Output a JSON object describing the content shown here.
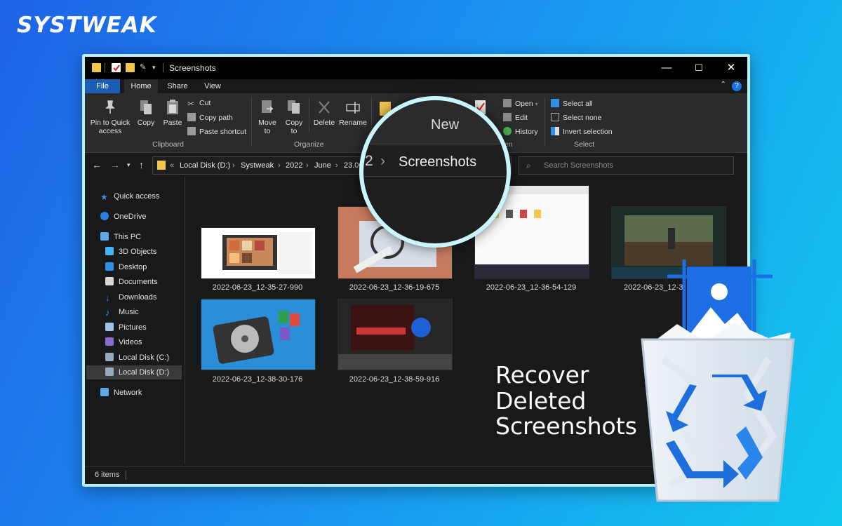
{
  "brand": {
    "logo_text": "SYSTWEAK"
  },
  "window": {
    "title": "Screenshots",
    "controls": {
      "minimize": "—",
      "maximize": "☐",
      "close": "✕"
    }
  },
  "tabs": [
    "File",
    "Home",
    "Share",
    "View"
  ],
  "ribbon": {
    "clipboard": {
      "pin": "Pin to Quick access",
      "copy": "Copy",
      "paste": "Paste",
      "cut": "Cut",
      "copy_path": "Copy path",
      "paste_shortcut": "Paste shortcut",
      "group": "Clipboard"
    },
    "organize": {
      "move_to": "Move to",
      "copy_to": "Copy to",
      "delete": "Delete",
      "rename": "Rename",
      "group": "Organize"
    },
    "new": {
      "group": "New"
    },
    "open": {
      "open": "Open",
      "edit": "Edit",
      "history": "History",
      "properties_partial": "ies",
      "group_partial": "en"
    },
    "select": {
      "select_all": "Select all",
      "select_none": "Select none",
      "invert": "Invert selection",
      "group": "Select"
    }
  },
  "address": {
    "overflow": "«",
    "crumbs": [
      "Local Disk (D:)",
      "Systweak",
      "2022",
      "June",
      "23.06"
    ],
    "sep": "›"
  },
  "search": {
    "placeholder": "Search Screenshots"
  },
  "sidebar": {
    "items": [
      {
        "label": "Quick access",
        "color": "#3b8eea"
      },
      {
        "label": "OneDrive",
        "color": "#2f7fe0"
      },
      {
        "label": "This PC",
        "color": "#5fa8e8"
      },
      {
        "label": "3D Objects",
        "color": "#44b3f2"
      },
      {
        "label": "Desktop",
        "color": "#2f8fe8"
      },
      {
        "label": "Documents",
        "color": "#d8d8d8"
      },
      {
        "label": "Downloads",
        "color": "#2f8fe8"
      },
      {
        "label": "Music",
        "color": "#3b8eea"
      },
      {
        "label": "Pictures",
        "color": "#9ec3e6"
      },
      {
        "label": "Videos",
        "color": "#8a6ad1"
      },
      {
        "label": "Local Disk (C:)",
        "color": "#9ab"
      },
      {
        "label": "Local Disk (D:)",
        "color": "#9ab"
      },
      {
        "label": "Network",
        "color": "#5fa8e8"
      }
    ]
  },
  "files": [
    "2022-06-23_12-35-27-990",
    "2022-06-23_12-36-19-675",
    "2022-06-23_12-36-54-129",
    "2022-06-23_12-3",
    "2022-06-23_12-38-30-176",
    "2022-06-23_12-38-59-916"
  ],
  "status": {
    "items": "6 items"
  },
  "magnifier": {
    "new_label": "New",
    "crumb_prefix": "2",
    "sep": "›",
    "crumb": "Screenshots"
  },
  "headline": {
    "line1": "Recover",
    "line2": "Deleted",
    "line3": "Screenshots"
  },
  "colors": {
    "accent": "#1a5fb4",
    "bg_start": "#1f63e6",
    "bg_end": "#12c8ee"
  }
}
